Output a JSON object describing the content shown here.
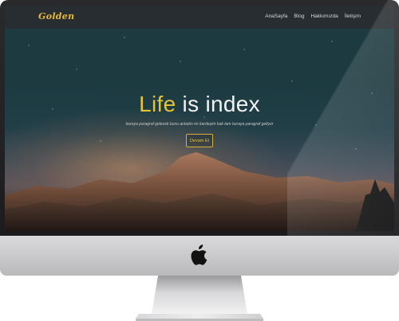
{
  "nav": {
    "brand": "Golden",
    "links": [
      "AnaSayfa",
      "Blog",
      "Hakkımızda",
      "İletişim"
    ]
  },
  "hero": {
    "title_accent": "Life",
    "title_rest": " is index",
    "subtitle": "buraya paragraf gelecek bunu anladın mı kardeşim bak tam buraya paragraf geliyor",
    "cta_label": "Devam Et"
  },
  "device": {
    "logo_icon": "apple-logo-icon"
  },
  "colors": {
    "accent": "#e6c23a",
    "navbar": "#282c30"
  }
}
